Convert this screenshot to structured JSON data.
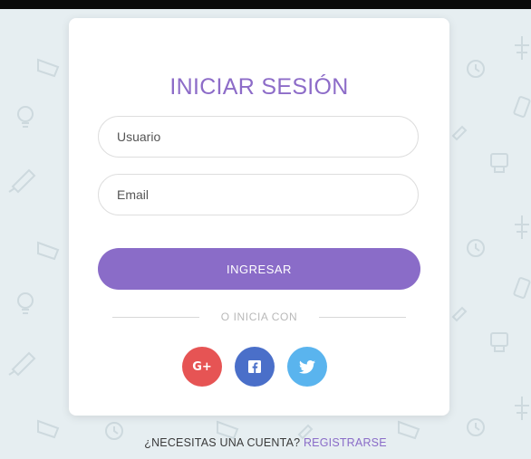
{
  "login": {
    "title": "INICIAR SESIÓN",
    "username_placeholder": "Usuario",
    "email_placeholder": "Email",
    "submit_label": "INGRESAR",
    "divider_text": "O INICIA CON"
  },
  "social": [
    {
      "name": "google-plus",
      "icon": "google-plus-icon",
      "label": "G+",
      "color": "#e65454"
    },
    {
      "name": "facebook",
      "icon": "facebook-icon",
      "color": "#4a6fc9"
    },
    {
      "name": "twitter",
      "icon": "twitter-icon",
      "color": "#5ab4ee"
    }
  ],
  "footer": {
    "question": "¿NECESITAS UNA CUENTA?",
    "link_label": "REGISTRARSE"
  },
  "colors": {
    "accent": "#8a6cc8",
    "background": "#e6eef1",
    "top_bar": "#0a0a0a"
  }
}
